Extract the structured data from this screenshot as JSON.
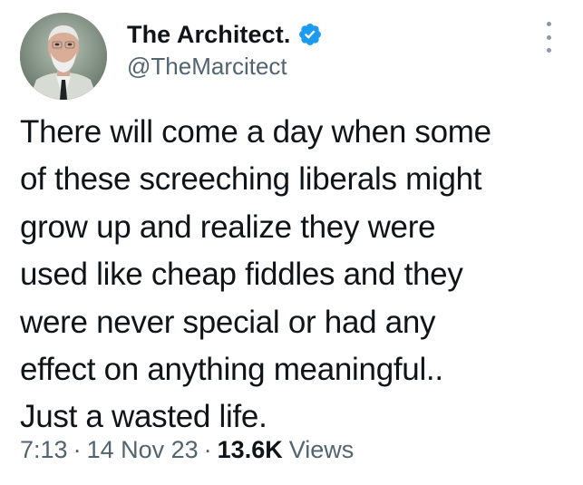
{
  "author": {
    "display_name": "The Architect.",
    "handle": "@TheMarcitect",
    "verified": true,
    "verified_color": "#1d9bf0"
  },
  "tweet": {
    "lines": [
      "There will come a day when some",
      "of these screeching liberals might",
      "grow up and realize they were",
      "used like cheap fiddles and they",
      "were never special or had any",
      "effect on anything meaningful..",
      "Just a wasted life."
    ]
  },
  "meta": {
    "time": "7:13",
    "separator": "·",
    "date": "14 Nov 23",
    "views_count": "13.6K",
    "views_label": "Views"
  },
  "icons": {
    "more": "more-options-icon",
    "verified": "verified-badge-icon"
  },
  "colors": {
    "text_primary": "#0f1419",
    "text_secondary": "#536471",
    "verified_blue": "#1d9bf0"
  }
}
